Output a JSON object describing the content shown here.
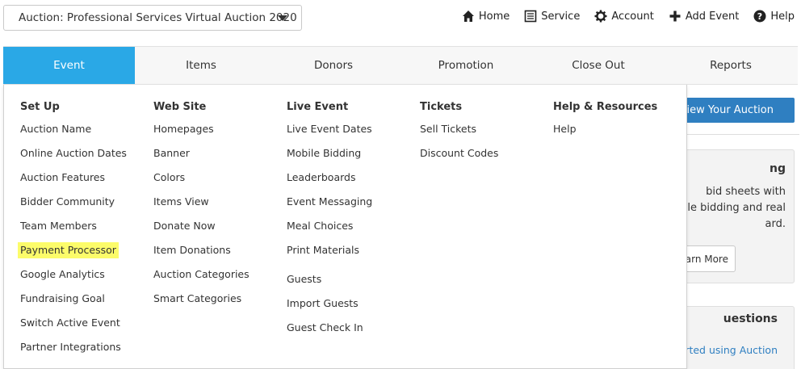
{
  "auction_select": {
    "value": "Auction: Professional Services Virtual Auction 2020"
  },
  "topnav": [
    {
      "label": "Home",
      "icon": "home-icon"
    },
    {
      "label": "Service",
      "icon": "document-icon"
    },
    {
      "label": "Account",
      "icon": "gear-icon"
    },
    {
      "label": "Add Event",
      "icon": "plus-icon"
    },
    {
      "label": "Help",
      "icon": "question-icon"
    }
  ],
  "mainnav": {
    "tabs": [
      "Event",
      "Items",
      "Donors",
      "Promotion",
      "Close Out",
      "Reports"
    ],
    "active": "Event",
    "active_color": "#2aa8e6"
  },
  "dropdown": {
    "columns": [
      {
        "heading": "Set Up",
        "items": [
          "Auction Name",
          "Online Auction Dates",
          "Auction Features",
          "Bidder Community",
          "Team Members",
          "Payment Processor",
          "Google Analytics",
          "Fundraising Goal",
          "Switch Active Event",
          "Partner Integrations"
        ]
      },
      {
        "heading": "Web Site",
        "items": [
          "Homepages",
          "Banner",
          "Colors",
          "Items View",
          "Donate Now",
          "Item Donations",
          "Auction Categories",
          "Smart Categories"
        ]
      },
      {
        "heading": "Live Event",
        "items": [
          "Live Event Dates",
          "Mobile Bidding",
          "Leaderboards",
          "Event Messaging",
          "Meal Choices",
          "Print Materials",
          "Guests",
          "Import Guests",
          "Guest Check In"
        ]
      },
      {
        "heading": "Tickets",
        "items": [
          "Sell Tickets",
          "Discount Codes"
        ]
      },
      {
        "heading": "Help & Resources",
        "items": [
          "Help"
        ]
      }
    ],
    "highlighted_item": "Payment Processor",
    "highlight_color": "#fcfc6a"
  },
  "right_panel": {
    "view_button": "View Your Auction",
    "promo_title": "ng",
    "promo_lines": [
      "bid sheets with",
      "le bidding and real",
      "ard."
    ],
    "learn_more": "earn More",
    "questions_title": "uestions",
    "questions_link": "tarted using Auction"
  }
}
